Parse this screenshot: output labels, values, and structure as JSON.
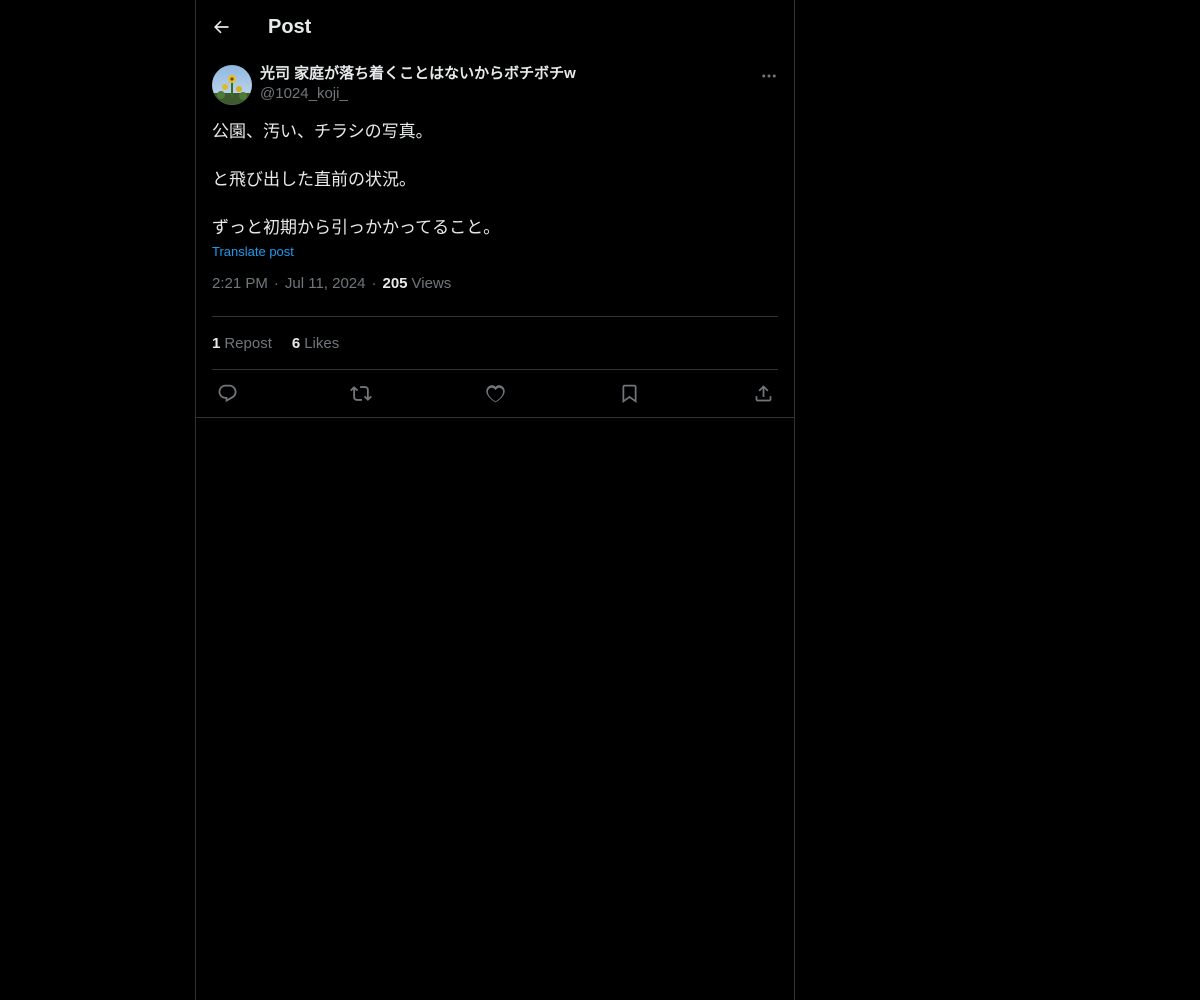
{
  "header": {
    "title": "Post"
  },
  "post": {
    "display_name": "光司 家庭が落ち着くことはないからボチボチw",
    "handle": "@1024_koji_",
    "lines": [
      "公園、汚い、チラシの写真。",
      "",
      "と飛び出した直前の状況。",
      "",
      "ずっと初期から引っかかってること。"
    ],
    "translate_label": "Translate post",
    "time": "2:21 PM",
    "date": "Jul 11, 2024",
    "views_count": "205",
    "views_label": "Views",
    "reposts_count": "1",
    "reposts_label": "Repost",
    "likes_count": "6",
    "likes_label": "Likes"
  },
  "colors": {
    "background": "#000000",
    "text": "#e7e9ea",
    "muted": "#71767b",
    "accent": "#1d9bf0",
    "border": "#2f3336"
  },
  "icons": {
    "back": "arrow-left-icon",
    "more": "more-horizontal-icon",
    "reply": "reply-icon",
    "repost": "repost-icon",
    "like": "heart-icon",
    "bookmark": "bookmark-icon",
    "share": "share-icon"
  }
}
